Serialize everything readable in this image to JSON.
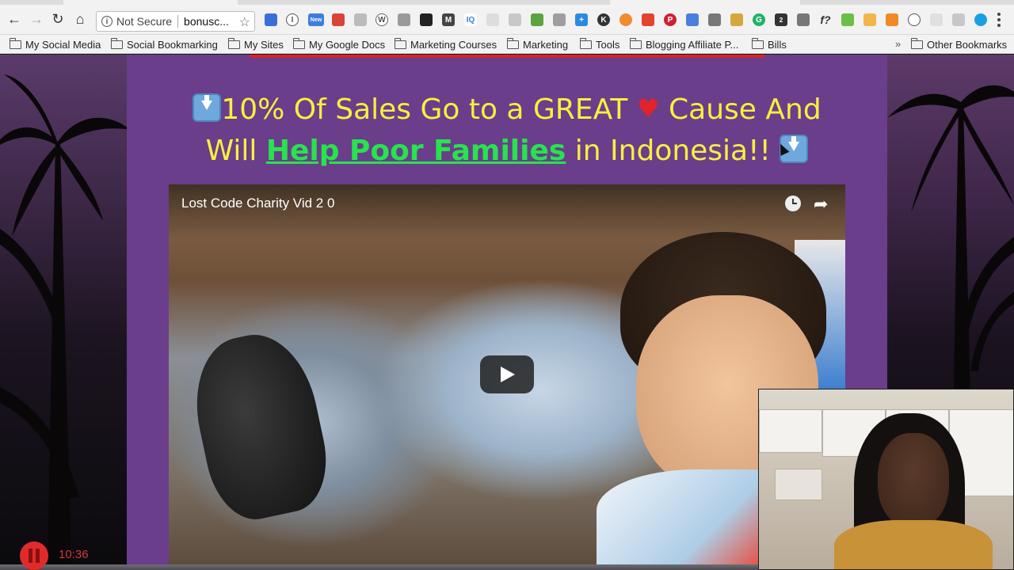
{
  "browser": {
    "security_label": "Not Secure",
    "url": "bonusc...",
    "extension_badge_new": "New",
    "extension_badge_count": "2",
    "extension_f_label": "f?"
  },
  "bookmarks": {
    "items": [
      "My Social Media",
      "Social Bookmarking",
      "My Sites",
      "My Google Docs",
      "Marketing Courses",
      "Marketing",
      "Tools",
      "Blogging Affiliate P...",
      "Bills"
    ],
    "overflow": "»",
    "other": "Other Bookmarks"
  },
  "page": {
    "headline_part1": "10% Of Sales Go to a GREAT",
    "headline_part2": "Cause And",
    "headline_part3": "Will",
    "headline_link": "Help Poor Families",
    "headline_part4": "in Indonesia!!"
  },
  "video": {
    "title": "Lost Code Charity Vid 2 0"
  },
  "recording": {
    "time": "10:36"
  },
  "colors": {
    "page_bg": "#6a3e8a",
    "headline": "#f9ef3f",
    "link": "#27e34d",
    "accent_red": "#d8232a"
  }
}
